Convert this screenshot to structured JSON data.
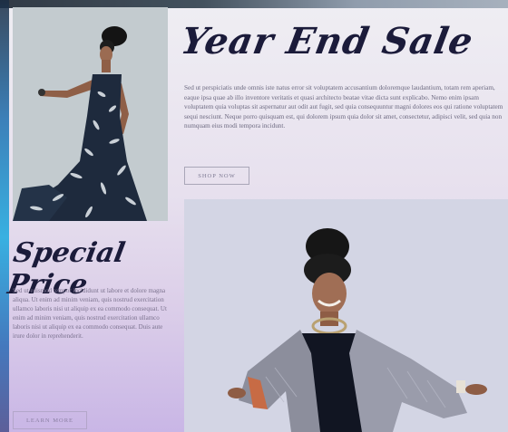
{
  "hero": {
    "title": "Year End Sale",
    "body": "Sed ut perspiciatis unde omnis iste natus error sit voluptatem accusantium doloremque laudantium, totam rem aperiam, eaque ipsa quae ab illo inventore veritatis et quasi architecto beatae vitae dicta sunt explicabo. Nemo enim ipsam voluptatem quia voluptas sit aspernatur aut odit aut fugit, sed quia consequuntur magni dolores eos qui ratione voluptatem sequi nesciunt. Neque porro quisquam est, qui dolorem ipsum quia dolor sit amet, consectetur, adipisci velit, sed quia non numquam eius modi tempora incidunt.",
    "button_label": "SHOP NOW"
  },
  "special": {
    "title": "Special Price",
    "body": "Sed ut euismod tempor incididunt ut labore et dolore magna aliqua. Ut enim ad minim veniam, quis nostrud exercitation ullamco laboris nisi ut aliquip ex ea commodo consequat. Ut enim ad minim veniam, quis nostrud exercitation ullamco laboris nisi ut aliquip ex ea commodo consequat. Duis aute irure dolor in reprehenderit.",
    "button_label": "LEARN MORE"
  },
  "colors": {
    "heading": "#1b1b3a",
    "body_text": "#6d6a80",
    "accent_lavender": "#c9b6e6"
  }
}
